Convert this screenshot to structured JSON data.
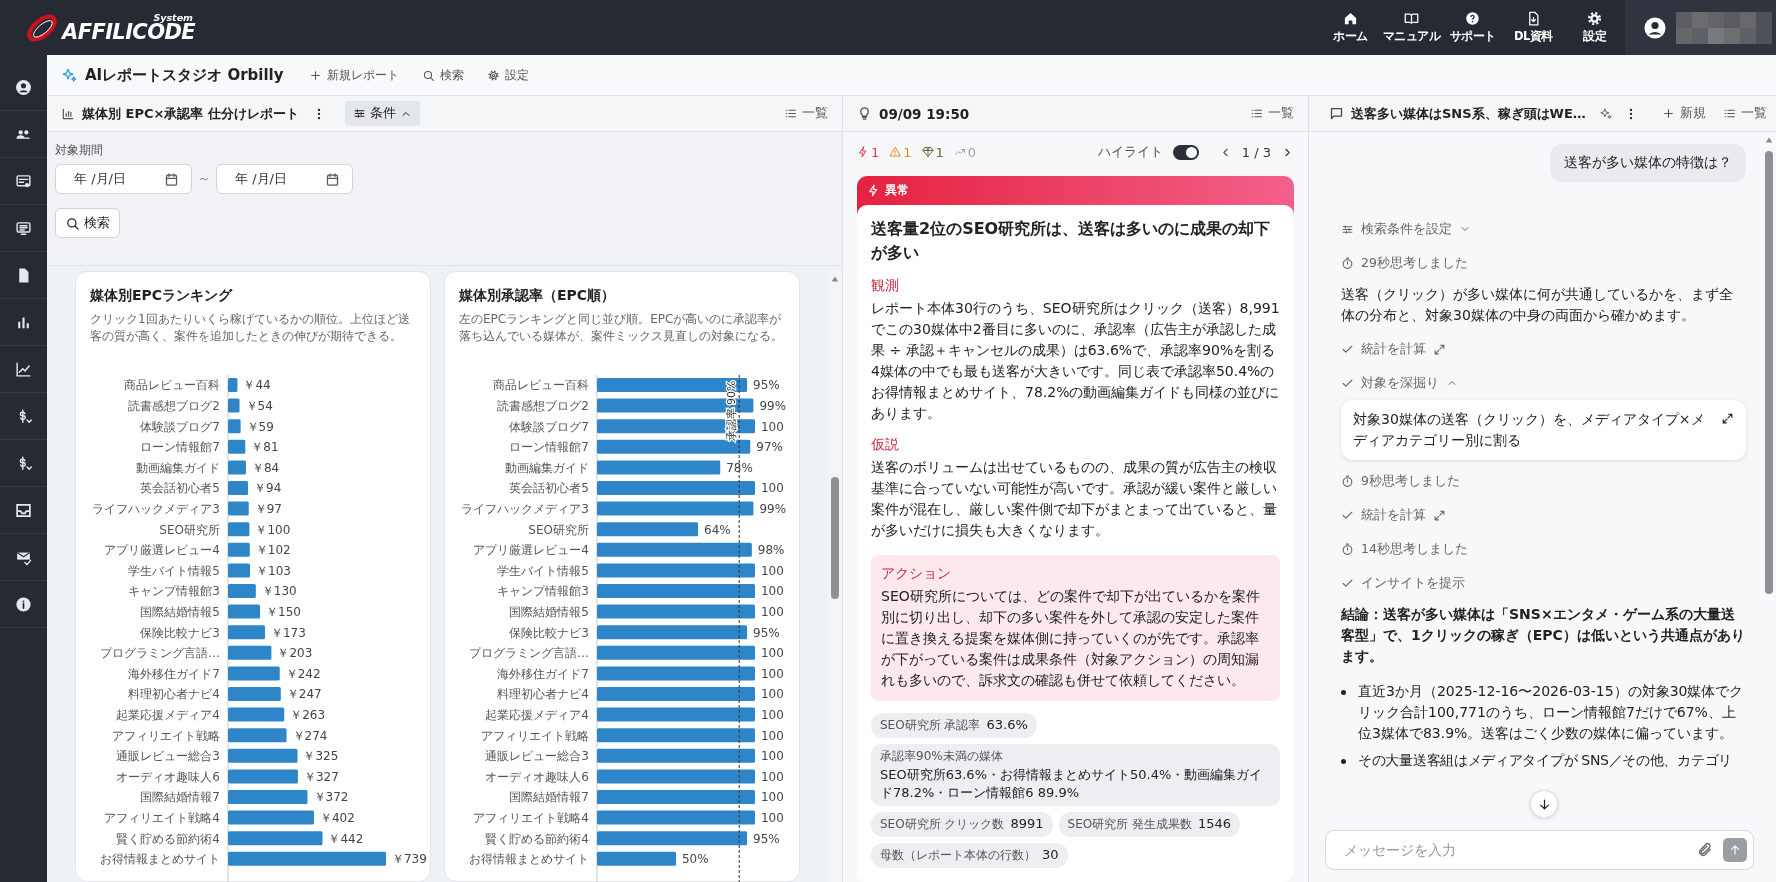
{
  "topbar": {
    "logo": "AFFILICODE",
    "logo_sub": "System",
    "nav": [
      {
        "label": "ホーム"
      },
      {
        "label": "マニュアル"
      },
      {
        "label": "サポート"
      },
      {
        "label": "DL資料"
      },
      {
        "label": "設定"
      }
    ]
  },
  "studio": {
    "title": "AIレポートスタジオ Orbilly",
    "actions": [
      {
        "label": "新規レポート"
      },
      {
        "label": "検索"
      },
      {
        "label": "設定"
      }
    ]
  },
  "report": {
    "title": "媒体別 EPC×承認率 仕分けレポート",
    "conditions": {
      "label": "条件",
      "expanded": true
    },
    "list_label": "一覧",
    "filter": {
      "label": "対象期間",
      "from": {
        "placeholder": "年 /月/日"
      },
      "separator": "~",
      "to": {
        "placeholder": "年 /月/日"
      },
      "search": "検索"
    },
    "cards": [
      {
        "title": "媒体別EPCランキング",
        "description": "クリック1回あたりいくら稼げているかの順位。上位ほど送客の質が高く、案件を追加したときの伸びが期待できる。",
        "chart_data": {
          "type": "bar",
          "orientation": "horizontal",
          "categories": [
            "商品レビュー百科",
            "読書感想ブログ2",
            "体験談ブログ7",
            "ローン情報館7",
            "動画編集ガイド",
            "英会話初心者5",
            "ライフハックメディア3",
            "SEO研究所",
            "アプリ厳選レビュー4",
            "学生バイト情報5",
            "キャンプ情報館3",
            "国際結婚情報5",
            "保険比較ナビ3",
            "プログラミング言語…",
            "海外移住ガイド7",
            "料理初心者ナビ4",
            "起業応援メディア4",
            "アフィリエイト戦略",
            "通販レビュー総合3",
            "オーディオ趣味人6",
            "国際結婚情報7",
            "アフィリエイト戦略4",
            "賢く貯める節約術4",
            "お得情報まとめサイト"
          ],
          "values": [
            44,
            54,
            59,
            81,
            84,
            94,
            97,
            100,
            102,
            103,
            130,
            150,
            173,
            203,
            242,
            247,
            263,
            274,
            325,
            327,
            372,
            402,
            442,
            739
          ],
          "value_labels": [
            "￥44",
            "￥54",
            "￥59",
            "￥81",
            "￥84",
            "￥94",
            "￥97",
            "￥100",
            "￥102",
            "￥103",
            "￥130",
            "￥150",
            "￥173",
            "￥203",
            "￥242",
            "￥247",
            "￥263",
            "￥274",
            "￥325",
            "￥327",
            "￥372",
            "￥402",
            "￥442",
            "￥739"
          ]
        }
      },
      {
        "title": "媒体別承認率（EPC順）",
        "description": "左のEPCランキングと同じ並び順。EPCが高いのに承認率が落ち込んでいる媒体が、案件ミックス見直しの対象になる。",
        "chart_data": {
          "type": "bar",
          "orientation": "horizontal",
          "categories": [
            "商品レビュー百科",
            "読書感想ブログ2",
            "体験談ブログ7",
            "ローン情報館7",
            "動画編集ガイド",
            "英会話初心者5",
            "ライフハックメディア3",
            "SEO研究所",
            "アプリ厳選レビュー4",
            "学生バイト情報5",
            "キャンプ情報館3",
            "国際結婚情報5",
            "保険比較ナビ3",
            "プログラミング言語…",
            "海外移住ガイド7",
            "料理初心者ナビ4",
            "起業応援メディア4",
            "アフィリエイト戦略",
            "通販レビュー総合3",
            "オーディオ趣味人6",
            "国際結婚情報7",
            "アフィリエイト戦略4",
            "賢く貯める節約術4",
            "お得情報まとめサイト"
          ],
          "values": [
            95,
            99,
            100,
            97,
            78,
            100,
            99,
            64,
            98,
            100,
            100,
            100,
            95,
            100,
            100,
            100,
            100,
            100,
            100,
            100,
            100,
            100,
            95,
            50
          ],
          "value_labels": [
            "95%",
            "99%",
            "100",
            "97%",
            "78%",
            "100",
            "99%",
            "64%",
            "98%",
            "100",
            "100",
            "100",
            "95%",
            "100",
            "100",
            "100",
            "100",
            "100",
            "100",
            "100",
            "100",
            "100",
            "95%",
            "50%"
          ],
          "ref_lines": [
            {
              "axis": "x",
              "value": 90,
              "label": "承認率 90%"
            }
          ]
        }
      }
    ]
  },
  "insight": {
    "timestamp": "09/09 19:50",
    "list_label": "一覧",
    "counters": [
      {
        "kind": "anomaly",
        "count": "1",
        "disabled": false
      },
      {
        "kind": "warning",
        "count": "1",
        "disabled": false
      },
      {
        "kind": "opportunity",
        "count": "1",
        "disabled": false
      },
      {
        "kind": "trend",
        "count": "0",
        "disabled": true
      }
    ],
    "highlight": {
      "label": "ハイライト",
      "on": true
    },
    "pager": "1 / 3",
    "card": {
      "badge": "異常",
      "title": "送客量2位のSEO研究所は、送客は多いのに成果の却下が多い",
      "sections": [
        {
          "heading": "観測",
          "text": "レポート本体30行のうち、SEO研究所はクリック（送客）8,991でこの30媒体中2番目に多いのに、承認率（広告主が承認した成果 ÷ 承認＋キャンセルの成果）は63.6%で、承認率90%を割る4媒体の中でも最も送客が大きいです。同じ表で承認率50.4%のお得情報まとめサイト、78.2%の動画編集ガイドも同様の並びにあります。"
        },
        {
          "heading": "仮説",
          "text": "送客のボリュームは出せているものの、成果の質が広告主の検収基準に合っていない可能性が高いです。承認が緩い案件と厳しい案件が混在し、厳しい案件側で却下がまとまって出ていると、量が多いだけに損失も大きくなります。"
        }
      ],
      "action": {
        "heading": "アクション",
        "text": "SEO研究所については、どの案件で却下が出ているかを案件別に切り出し、却下の多い案件を外して承認の安定した案件に置き換える提案を媒体側に持っていくのが先です。承認率が下がっている案件は成果条件（対象アクション）の周知漏れも多いので、訴求文の確認も併せて依頼してください。"
      },
      "chips": [
        {
          "kind": "inline",
          "label": "SEO研究所 承認率",
          "value": "63.6%"
        },
        {
          "kind": "block",
          "label": "承認率90%未満の媒体",
          "value": "SEO研究所63.6%・お得情報まとめサイト50.4%・動画編集ガイド78.2%・ローン情報館6 89.9%"
        },
        {
          "kind": "inline",
          "label": "SEO研究所 クリック数",
          "value": "8991"
        },
        {
          "kind": "inline",
          "label": "SEO研究所 発生成果数",
          "value": "1546"
        },
        {
          "kind": "inline",
          "label": "母数（レポート本体の行数）",
          "value": "30"
        }
      ]
    }
  },
  "chat": {
    "title": "送客多い媒体はSNS系、稼ぎ頭はWE…",
    "new_label": "新規",
    "list_label": "一覧",
    "messages": [
      {
        "kind": "user",
        "text": "送客が多い媒体の特徴は？"
      },
      {
        "kind": "setting",
        "text": "検索条件を設定",
        "expanded": false
      },
      {
        "kind": "thought",
        "text": "29秒思考しました"
      },
      {
        "kind": "text",
        "text": "送客（クリック）が多い媒体に何が共通しているかを、まず全体の分布と、対象30媒体の中身の両面から確かめます。"
      },
      {
        "kind": "tool",
        "text": "統計を計算"
      },
      {
        "kind": "step",
        "text": "対象を深掘り",
        "expanded": true
      },
      {
        "kind": "detail",
        "text": "対象30媒体の送客（クリック）を、メディアタイプ×メディアカテゴリー別に割る"
      },
      {
        "kind": "thought",
        "text": "9秒思考しました"
      },
      {
        "kind": "tool",
        "text": "統計を計算"
      },
      {
        "kind": "thought",
        "text": "14秒思考しました"
      },
      {
        "kind": "step",
        "text": "インサイトを提示"
      },
      {
        "kind": "conclusion",
        "text": "結論：送客が多い媒体は「SNS×エンタメ・ゲーム系の大量送客型」で、1クリックの稼ぎ（EPC）は低いという共通点があります。"
      },
      {
        "kind": "bullets",
        "items": [
          "直近3か月（2025-12-16〜2026-03-15）の対象30媒体でクリック合計100,771のうち、ローン情報館7だけで67%、上位3媒体で83.9%。送客はごく少数の媒体に偏っています。",
          "その大量送客組はメディアタイプが SNS／その他、カテゴリ"
        ]
      }
    ],
    "input": {
      "placeholder": "メッセージを入力"
    }
  }
}
